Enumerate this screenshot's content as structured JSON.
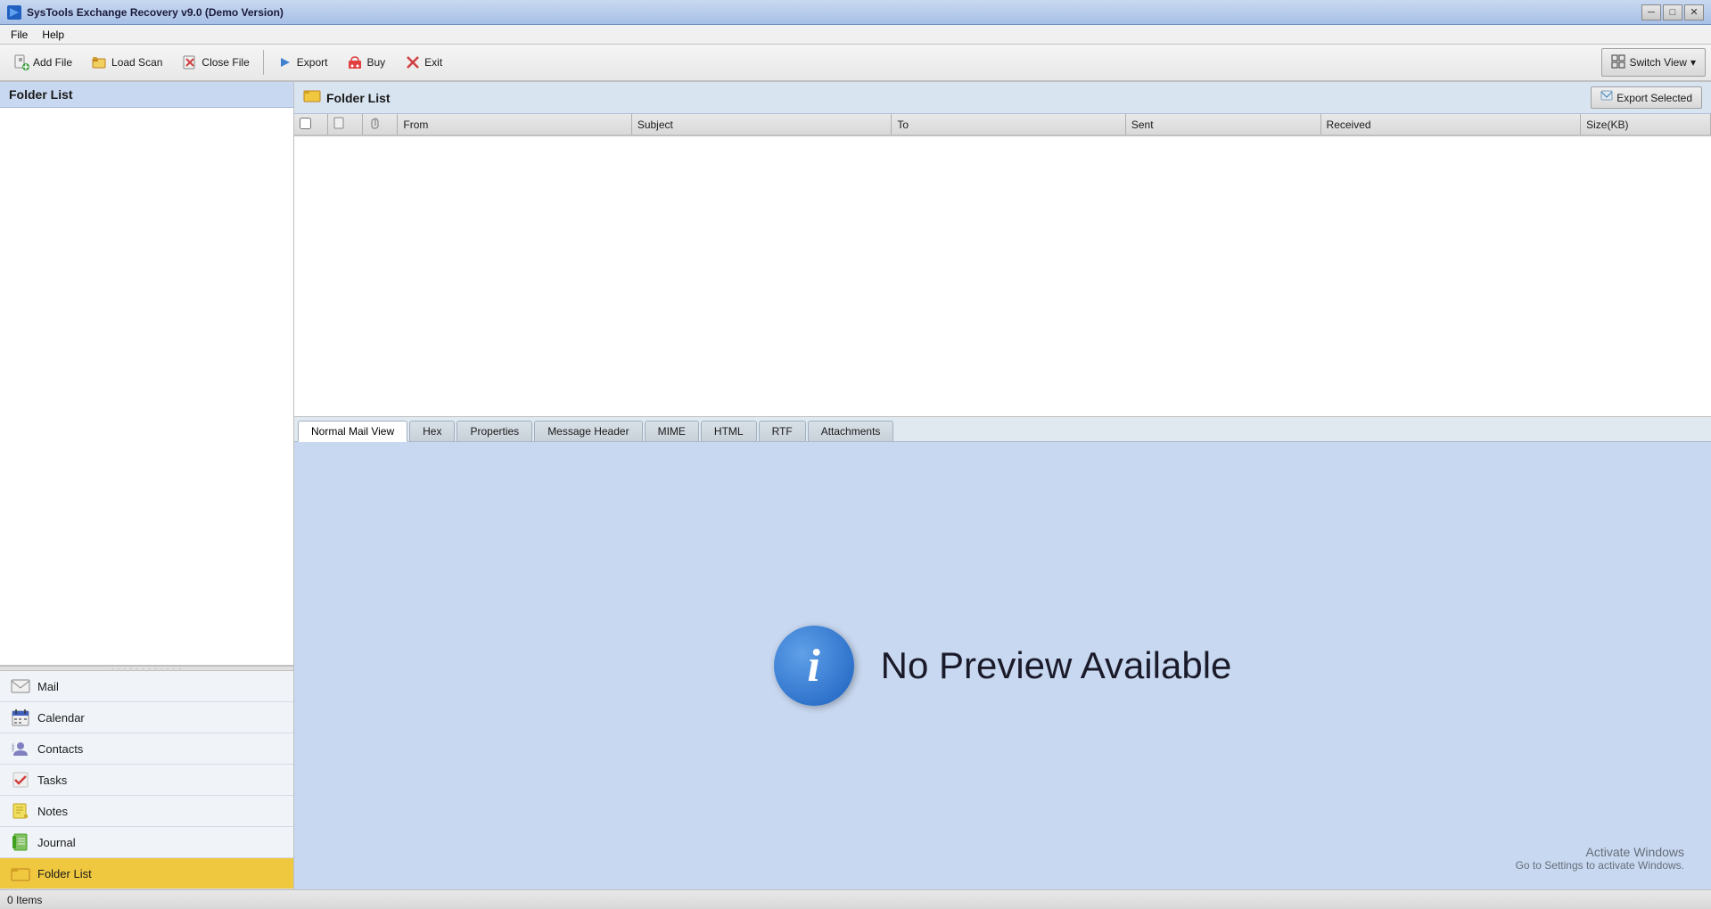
{
  "titleBar": {
    "title": "SysTools Exchange Recovery v9.0 (Demo Version)",
    "logo": "▶",
    "controls": {
      "minimize": "─",
      "maximize": "□",
      "close": "✕"
    }
  },
  "menuBar": {
    "items": [
      {
        "id": "file",
        "label": "File"
      },
      {
        "id": "help",
        "label": "Help"
      }
    ]
  },
  "toolbar": {
    "buttons": [
      {
        "id": "add-file",
        "icon": "📄",
        "label": "Add File"
      },
      {
        "id": "load-scan",
        "icon": "📂",
        "label": "Load Scan"
      },
      {
        "id": "close-file",
        "icon": "✖",
        "label": "Close File"
      },
      {
        "id": "export",
        "icon": "▶",
        "label": "Export"
      },
      {
        "id": "buy",
        "icon": "🛒",
        "label": "Buy"
      },
      {
        "id": "exit",
        "icon": "✕",
        "label": "Exit"
      }
    ],
    "switchView": {
      "icon": "⊞",
      "label": "Switch View",
      "dropdown": "▾"
    }
  },
  "sidebar": {
    "folderListTitle": "Folder List",
    "navItems": [
      {
        "id": "mail",
        "icon": "✉",
        "label": "Mail",
        "active": false
      },
      {
        "id": "calendar",
        "icon": "📅",
        "label": "Calendar",
        "active": false
      },
      {
        "id": "contacts",
        "icon": "👤",
        "label": "Contacts",
        "active": false
      },
      {
        "id": "tasks",
        "icon": "✅",
        "label": "Tasks",
        "active": false
      },
      {
        "id": "notes",
        "icon": "📝",
        "label": "Notes",
        "active": false
      },
      {
        "id": "journal",
        "icon": "📓",
        "label": "Journal",
        "active": false
      },
      {
        "id": "folder-list",
        "icon": "📁",
        "label": "Folder List",
        "active": true
      }
    ]
  },
  "rightPanel": {
    "header": {
      "icon": "📁",
      "title": "Folder List",
      "exportSelectedLabel": "Export Selected"
    },
    "table": {
      "columns": [
        {
          "id": "checkbox",
          "label": ""
        },
        {
          "id": "type",
          "label": ""
        },
        {
          "id": "attach",
          "label": ""
        },
        {
          "id": "from",
          "label": "From"
        },
        {
          "id": "subject",
          "label": "Subject"
        },
        {
          "id": "to",
          "label": "To"
        },
        {
          "id": "sent",
          "label": "Sent"
        },
        {
          "id": "received",
          "label": "Received"
        },
        {
          "id": "size",
          "label": "Size(KB)"
        }
      ],
      "rows": []
    },
    "tabs": [
      {
        "id": "normal-mail-view",
        "label": "Normal Mail View",
        "active": true
      },
      {
        "id": "hex",
        "label": "Hex",
        "active": false
      },
      {
        "id": "properties",
        "label": "Properties",
        "active": false
      },
      {
        "id": "message-header",
        "label": "Message Header",
        "active": false
      },
      {
        "id": "mime",
        "label": "MIME",
        "active": false
      },
      {
        "id": "html",
        "label": "HTML",
        "active": false
      },
      {
        "id": "rtf",
        "label": "RTF",
        "active": false
      },
      {
        "id": "attachments",
        "label": "Attachments",
        "active": false
      }
    ],
    "preview": {
      "noPreviewText": "No Preview Available",
      "infoIcon": "i",
      "activateWindows": "Activate Windows",
      "activateWindowsSub": "Go to Settings to activate Windows."
    }
  },
  "statusBar": {
    "itemCount": "0 Items"
  }
}
